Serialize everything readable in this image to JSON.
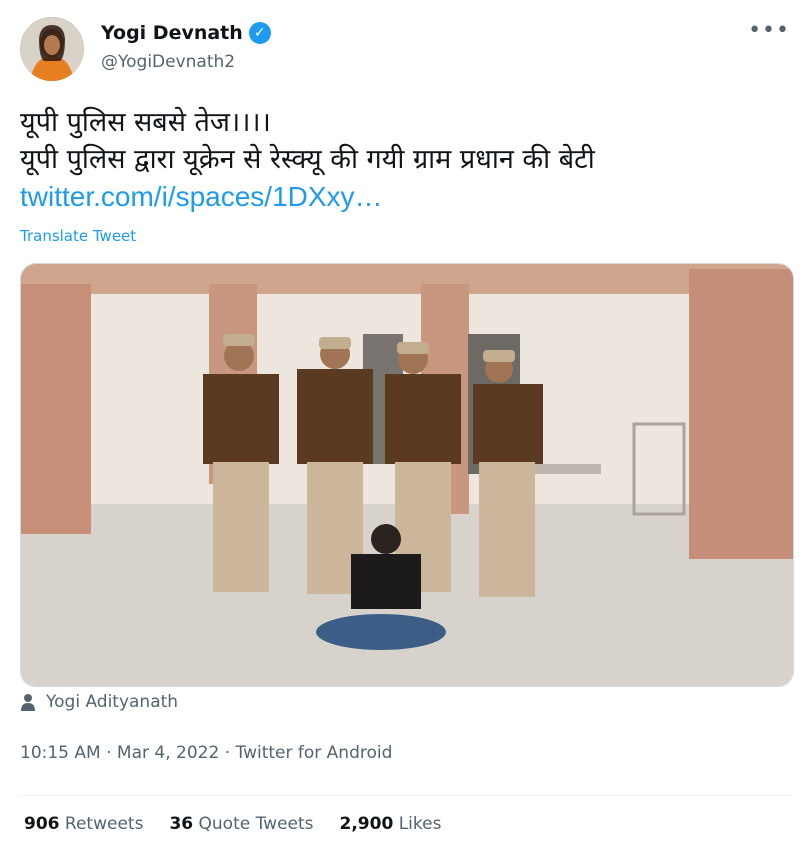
{
  "author": {
    "name": "Yogi Devnath",
    "handle": "@YogiDevnath2",
    "verified_icon": "✓"
  },
  "tweet": {
    "line1": "यूपी पुलिस सबसे तेज।।।।",
    "line2": "यूपी पुलिस द्वारा यूक्रेन से रेस्क्यू की गयी ग्राम प्रधान की बेटी",
    "link": "twitter.com/i/spaces/1DXxy…",
    "translate_label": "Translate Tweet"
  },
  "media": {
    "tagged_user": "Yogi Adityanath"
  },
  "meta": {
    "time": "10:15 AM",
    "date": "Mar 4, 2022",
    "source": "Twitter for Android",
    "separator": "·"
  },
  "stats": {
    "retweets_count": "906",
    "retweets_label": "Retweets",
    "quotes_count": "36",
    "quotes_label": "Quote Tweets",
    "likes_count": "2,900",
    "likes_label": "Likes"
  },
  "more_icon": "•••",
  "colors": {
    "accent": "#1d9bf0",
    "secondary_text": "#536471",
    "primary_text": "#0f1419"
  }
}
